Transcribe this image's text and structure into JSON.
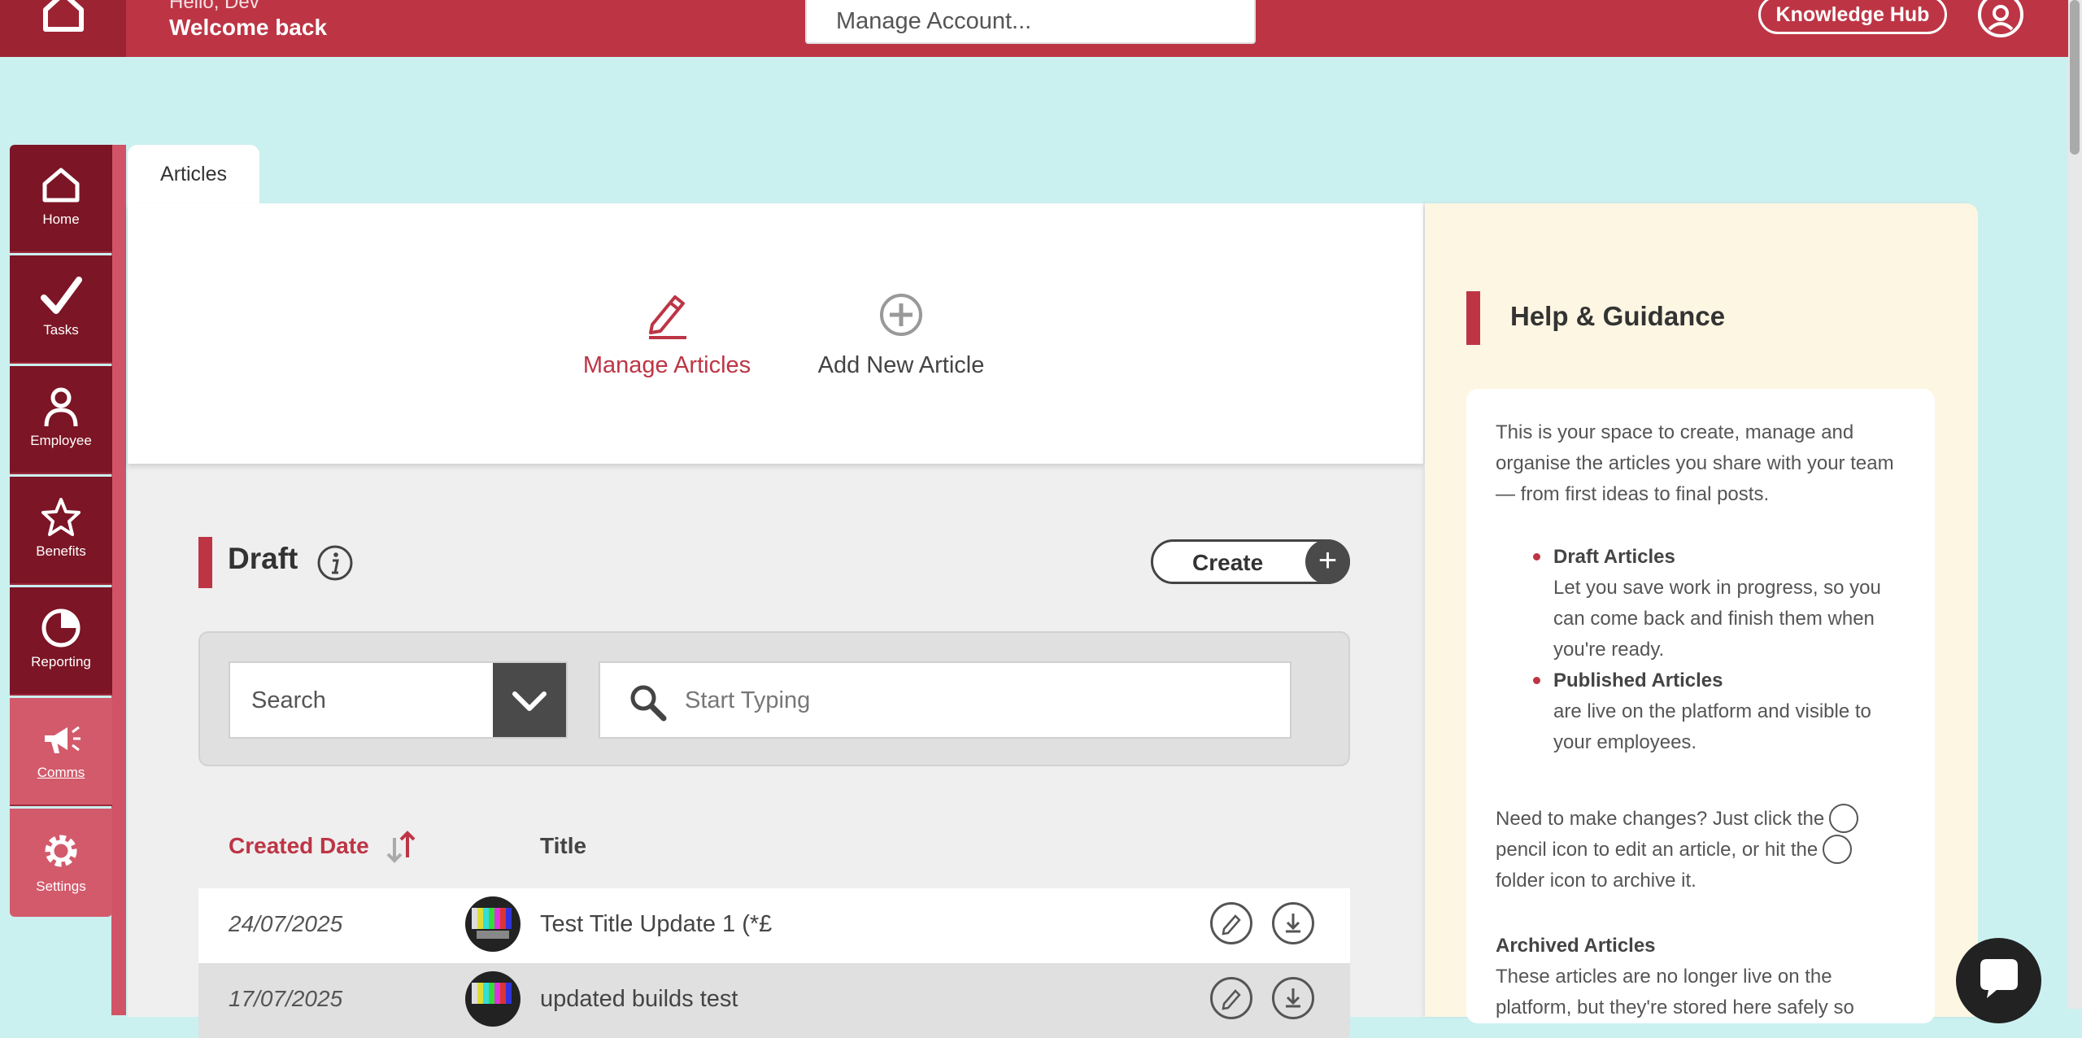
{
  "header": {
    "greeting": "Hello, Dev",
    "welcome": "Welcome back",
    "account_placeholder": "Manage Account...",
    "knowledge_hub": "Knowledge Hub"
  },
  "sidebar": {
    "items": [
      {
        "label": "Home",
        "icon": "home-icon"
      },
      {
        "label": "Tasks",
        "icon": "check-icon"
      },
      {
        "label": "Employee",
        "icon": "person-icon"
      },
      {
        "label": "Benefits",
        "icon": "star-icon"
      },
      {
        "label": "Reporting",
        "icon": "pie-chart-icon"
      },
      {
        "label": "Comms",
        "icon": "megaphone-icon",
        "active": true
      },
      {
        "label": "Settings",
        "icon": "gear-icon"
      }
    ]
  },
  "tabs": {
    "articles": "Articles"
  },
  "nav": {
    "manage": "Manage Articles",
    "add": "Add New Article"
  },
  "draft": {
    "title": "Draft",
    "create": "Create",
    "search_select": "Search",
    "search_placeholder": "Start Typing",
    "columns": {
      "created": "Created Date",
      "title": "Title"
    },
    "rows": [
      {
        "date": "24/07/2025",
        "title": "Test Title Update 1 (*£"
      },
      {
        "date": "17/07/2025",
        "title": "updated builds test"
      }
    ]
  },
  "help": {
    "title": "Help & Guidance",
    "intro": "This is your space to create, manage and organise the articles you share with your team — from first ideas to final posts.",
    "bullets": [
      {
        "title": "Draft Articles",
        "text": "Let you save work in progress, so you can come back and finish them when you're ready."
      },
      {
        "title": "Published Articles",
        "text": "are live on the platform and visible to your employees."
      }
    ],
    "changes_1": "Need to make changes? Just click the",
    "changes_2": "pencil icon to edit an article, or hit the",
    "changes_3": "folder icon to archive it.",
    "archived_title": "Archived Articles",
    "archived_text": "These articles are no longer live on the platform, but they're stored here safely so"
  },
  "colors": {
    "brand": "#bd3545",
    "sidebar": "#7c1525",
    "background": "#cbf0f0"
  }
}
